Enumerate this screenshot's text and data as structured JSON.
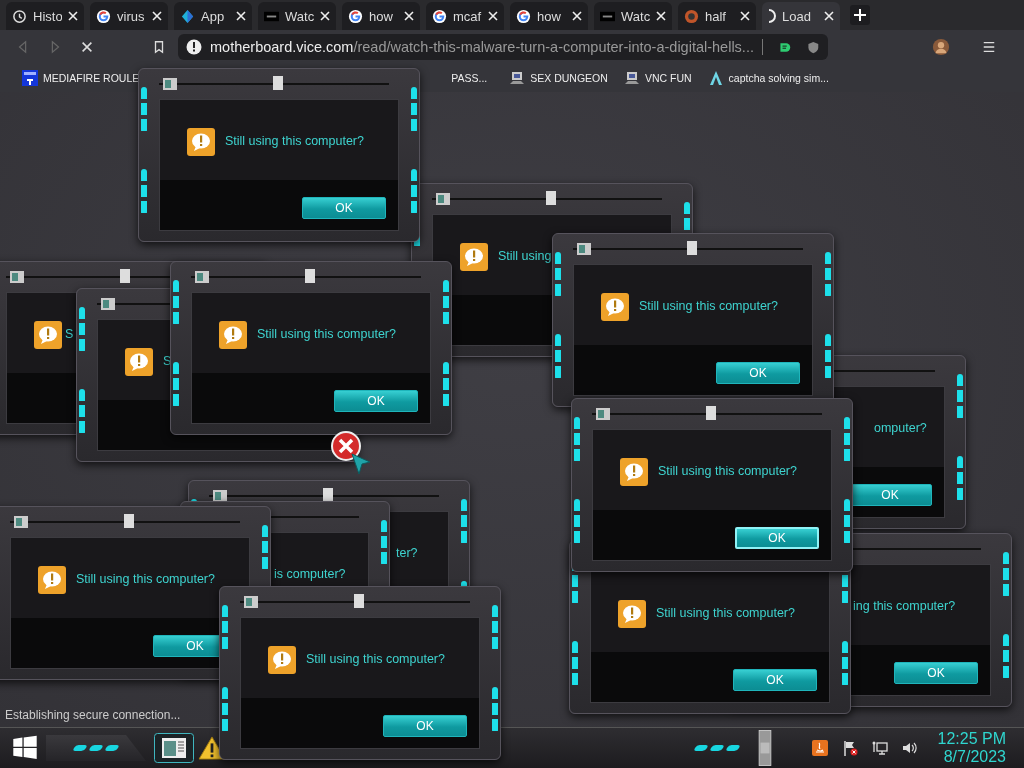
{
  "browser": {
    "tabs": [
      {
        "title": "Histo",
        "selected": false
      },
      {
        "title": "virus",
        "selected": false
      },
      {
        "title": "App",
        "selected": false
      },
      {
        "title": "Watc",
        "selected": false
      },
      {
        "title": "how",
        "selected": false
      },
      {
        "title": "mcaf",
        "selected": false
      },
      {
        "title": "how",
        "selected": false
      },
      {
        "title": "Watc",
        "selected": false
      },
      {
        "title": "half",
        "selected": false
      },
      {
        "title": "Load",
        "selected": true
      }
    ],
    "address": {
      "host": "motherboard.vice.com",
      "path": "/read/watch-this-malware-turn-a-computer-into-a-digital-hells..."
    },
    "bookmarks": [
      "MEDIAFIRE ROULE",
      "PASS...",
      "SEX DUNGEON",
      "VNC FUN",
      "captcha solving sim..."
    ]
  },
  "dialogs": [
    {
      "message": "Still using this computer?",
      "button": "OK"
    },
    {
      "message": "S"
    },
    {
      "message": "S"
    },
    {
      "message": "Still using this computer?",
      "button": "OK"
    },
    {
      "message": "Still using"
    },
    {
      "message": "Still using this computer?",
      "button": "OK"
    },
    {
      "message": "Still using this computer?",
      "button": "OK"
    },
    {
      "message": "omputer?",
      "button": "OK"
    },
    {
      "message": "Still using this computer?",
      "button": "OK"
    },
    {
      "message": "is computer?"
    },
    {
      "message": "ter?"
    },
    {
      "message": "Still using this computer?",
      "button": "OK"
    },
    {
      "message": "Still using this computer?",
      "button": "OK"
    },
    {
      "message": "ing this computer?",
      "button": "OK"
    }
  ],
  "status_text": "Establishing secure connection...",
  "taskbar": {
    "time": "12:25 PM",
    "date": "8/7/2023"
  }
}
